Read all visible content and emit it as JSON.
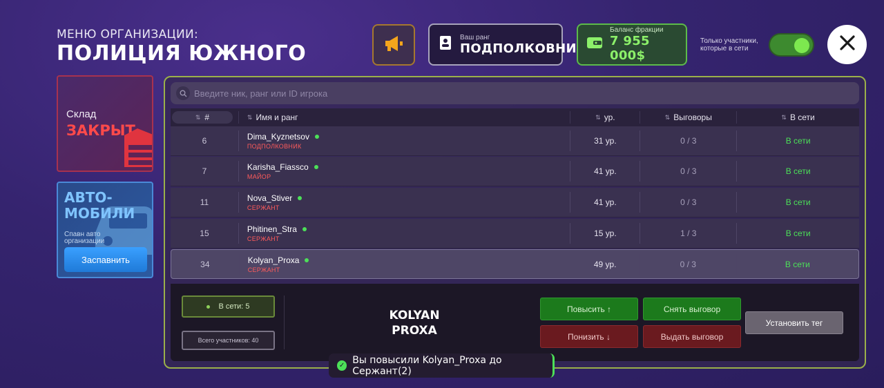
{
  "header": {
    "subtitle": "МЕНЮ ОРГАНИЗАЦИИ:",
    "title": "ПОЛИЦИЯ ЮЖНОГО",
    "rank_label": "Ваш ранг",
    "rank_value": "ПОДПОЛКОВНИК",
    "balance_label": "Баланс фракции",
    "balance_value": "7 955 000$",
    "toggle_label": "Только участники, которые в сети",
    "toggle_on": true
  },
  "cards": {
    "warehouse_label": "Склад",
    "warehouse_status": "ЗАКРЫТ",
    "cars_title": "АВТО-МОБИЛИ",
    "cars_desc": "Спавн авто организации",
    "spawn_button": "Заспавнить"
  },
  "search": {
    "placeholder": "Введите ник, ранг или ID игрока"
  },
  "table": {
    "columns": [
      "#",
      "Имя и ранг",
      "ур.",
      "Выговоры",
      "В сети"
    ],
    "rows": [
      {
        "id": "6",
        "nick": "Dima_Kyznetsov",
        "rank": "ПОДПОЛКОВНИК",
        "level": "31 ур.",
        "warnings": "0 / 3",
        "status": "В сети"
      },
      {
        "id": "7",
        "nick": "Karisha_Fiassco",
        "rank": "МАЙОР",
        "level": "41 ур.",
        "warnings": "0 / 3",
        "status": "В сети"
      },
      {
        "id": "11",
        "nick": "Nova_Stiver",
        "rank": "СЕРЖАНТ",
        "level": "41 ур.",
        "warnings": "0 / 3",
        "status": "В сети"
      },
      {
        "id": "15",
        "nick": "Phitinen_Stra",
        "rank": "СЕРЖАНТ",
        "level": "15 ур.",
        "warnings": "1 / 3",
        "status": "В сети"
      },
      {
        "id": "34",
        "nick": "Kolyan_Proxa",
        "rank": "СЕРЖАНТ",
        "level": "49 ур.",
        "warnings": "0 / 3",
        "status": "В сети"
      }
    ]
  },
  "bottom": {
    "online_count": "В сети: 5",
    "total_members": "Всего участников: 40",
    "selected_line1": "KOLYAN",
    "selected_line2": "PROXA",
    "promote": "Повысить ↑",
    "remove_warning": "Снять выговор",
    "demote": "Понизить ↓",
    "give_warning": "Выдать выговор",
    "set_tag": "Установить тег"
  },
  "toast": {
    "message": "Вы повысили Kolyan_Proxa до Сержант(2)"
  },
  "colors": {
    "accent_green": "#4ce058",
    "accent_red": "#ff5b5b",
    "panel_border": "#9bb04a",
    "background": "#35246f"
  }
}
